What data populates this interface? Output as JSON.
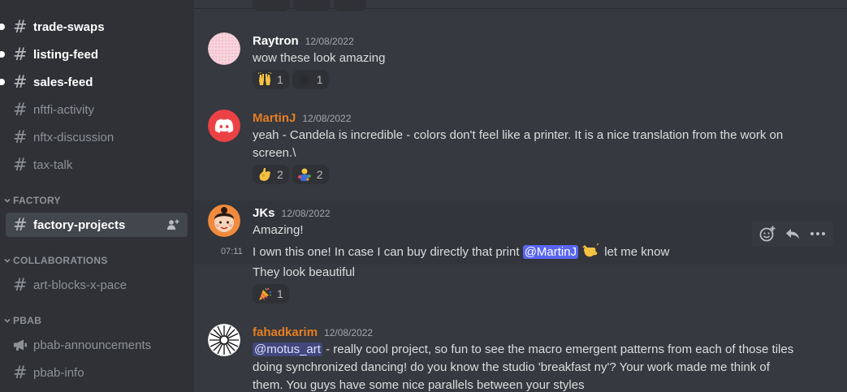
{
  "sidebar": {
    "channels": [
      {
        "name": "trade-swaps",
        "unread": true
      },
      {
        "name": "listing-feed",
        "unread": true
      },
      {
        "name": "sales-feed",
        "unread": true
      },
      {
        "name": "nftfi-activity",
        "unread": false
      },
      {
        "name": "nftx-discussion",
        "unread": false
      },
      {
        "name": "tax-talk",
        "unread": false
      }
    ],
    "categories": {
      "factory": "FACTORY",
      "collaborations": "COLLABORATIONS",
      "pbab": "PBAB"
    },
    "factory_channel": {
      "name": "factory-projects",
      "selected": true
    },
    "collab_channel": {
      "name": "art-blocks-x-pace"
    },
    "pbab_channels": [
      {
        "name": "pbab-announcements",
        "icon": "megaphone-icon"
      },
      {
        "name": "pbab-info",
        "icon": "hash-icon"
      }
    ]
  },
  "messages": [
    {
      "author": "Raytron",
      "author_color": "#ffffff",
      "time": "12/08/2022",
      "lines": [
        "wow these look amazing"
      ],
      "reactions": [
        {
          "emoji": "raised-hands-icon",
          "count": "1"
        },
        {
          "emoji": "dark-custom-emoji-icon",
          "count": "1"
        }
      ]
    },
    {
      "author": "MartinJ",
      "author_color": "#e67e22",
      "time": "12/08/2022",
      "lines": [
        "yeah - Candela is incredible - colors don't feel like a printer. It is a nice translation from the work on",
        "screen.\\"
      ],
      "reactions": [
        {
          "emoji": "ok-hand-icon",
          "count": "2"
        },
        {
          "emoji": "artist-emoji-icon",
          "count": "2"
        }
      ]
    },
    {
      "author": "JKs",
      "author_color": "#ffffff",
      "time": "12/08/2022",
      "line1": "Amazing!",
      "hover_time": "07:11",
      "line2_pre": "I own this one! In case I can buy directly that print ",
      "line2_mention": "@MartinJ",
      "line2_post": " let me know",
      "line3": "They look beautiful",
      "reactions": [
        {
          "emoji": "party-popper-icon",
          "count": "1"
        }
      ]
    },
    {
      "author": "fahadkarim",
      "author_color": "#e67e22",
      "time": "12/08/2022",
      "mention": "@motus_art",
      "line1_post": " - really cool project, so fun to see the macro emergent patterns from each of those tiles",
      "line2": "doing synchronized dancing! do you know the studio 'breakfast ny'? Your work made me think of",
      "line3": "them. You guys have some nice parallels between your styles"
    }
  ],
  "colors": {
    "sidebar_bg": "#2f3136",
    "chat_bg": "#36393f",
    "brand": "#5865f2",
    "discord_red": "#ed4245",
    "orange_name": "#e67e22"
  }
}
